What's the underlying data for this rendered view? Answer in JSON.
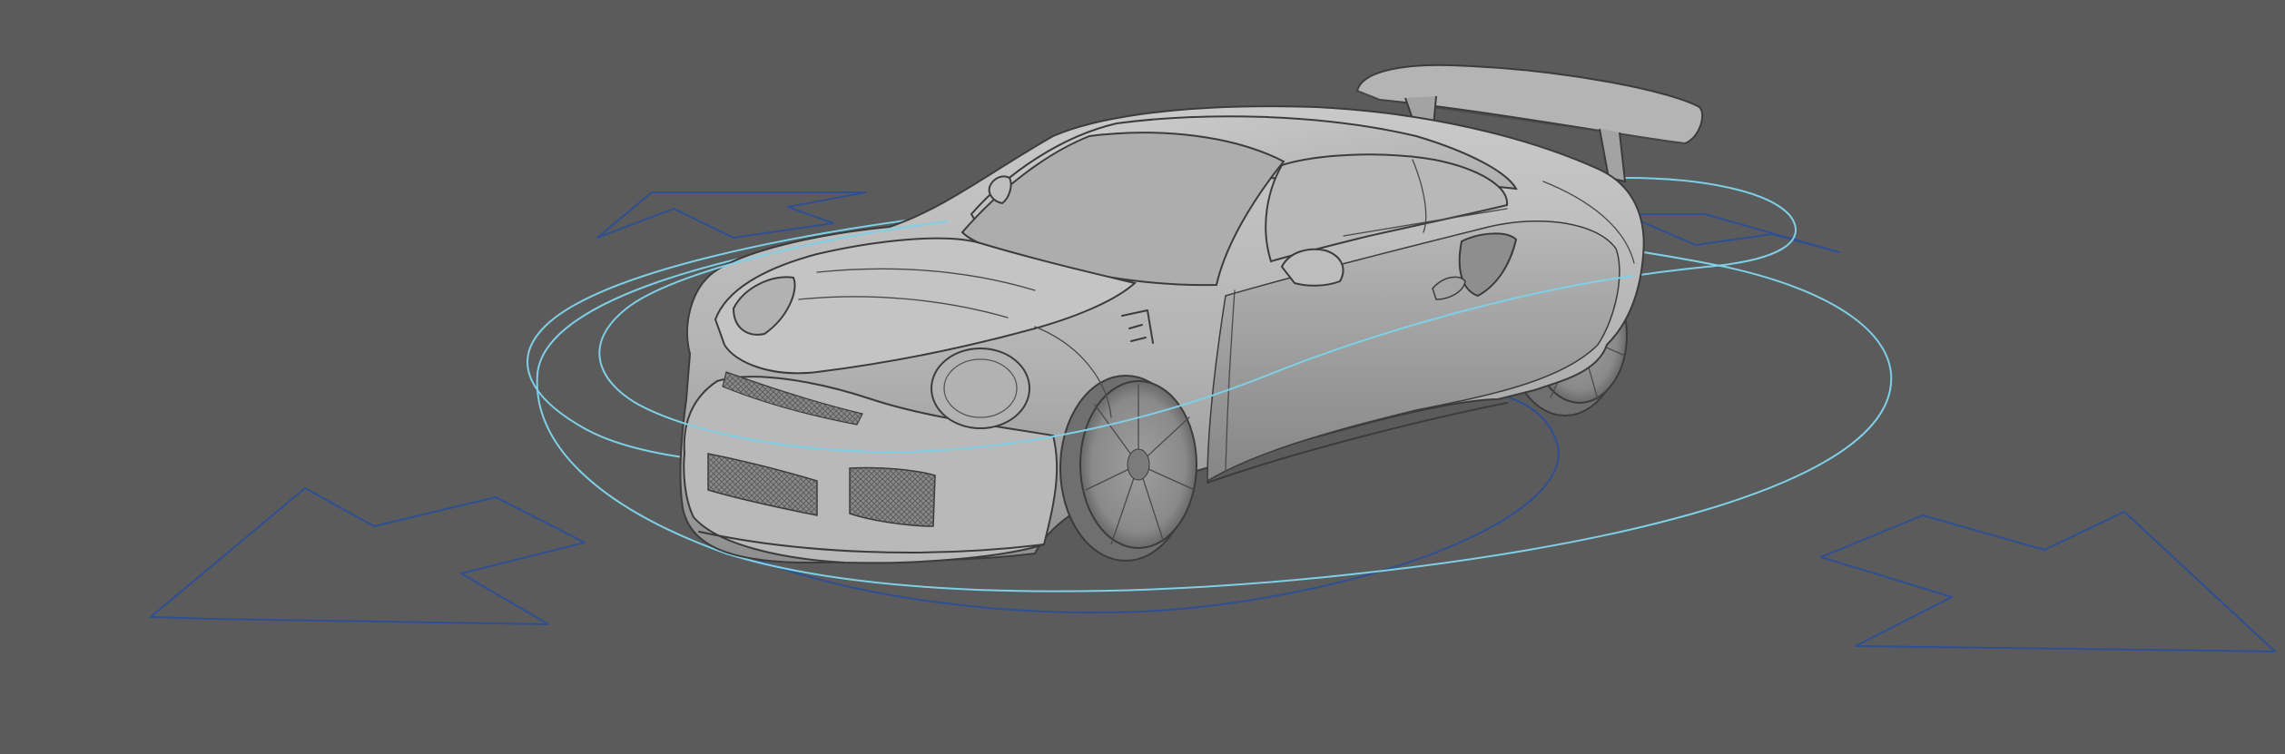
{
  "viewport": {
    "background_color": "#5b5b5b"
  },
  "scene": {
    "model": "sports-car",
    "model_color": "#b8b8b8",
    "model_shadow_color": "#8e8e8e",
    "model_highlight_color": "#d4d4d4"
  },
  "rig": {
    "inner_control_color": "#7fd0e6",
    "outer_control_color": "#2f4f93",
    "arrow_controls": [
      "move-arrow-left-back",
      "move-arrow-right-back",
      "move-arrow-left-front",
      "move-arrow-right-front"
    ]
  }
}
